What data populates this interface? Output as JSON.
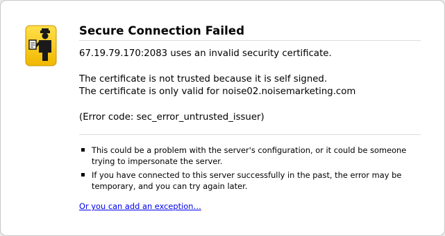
{
  "error": {
    "title": "Secure Connection Failed",
    "summary": "67.19.79.170:2083 uses an invalid security certificate.",
    "detail_line_1": "The certificate is not trusted because it is self signed.",
    "detail_line_2": "The certificate is only valid for noise02.noisemarketing.com",
    "error_code": "(Error code: sec_error_untrusted_issuer)"
  },
  "notes": [
    {
      "text": "This could be a problem with the server's configuration, or it could be someone trying to impersonate the server."
    },
    {
      "text": "If you have connected to this server successfully in the past, the error may be temporary, and you can try again later."
    }
  ],
  "exception_link": {
    "label": "Or you can add an exception…"
  },
  "icon": {
    "name": "security-officer-icon",
    "bg_color": "#f3c300",
    "fg_color": "#1a1a1a"
  }
}
